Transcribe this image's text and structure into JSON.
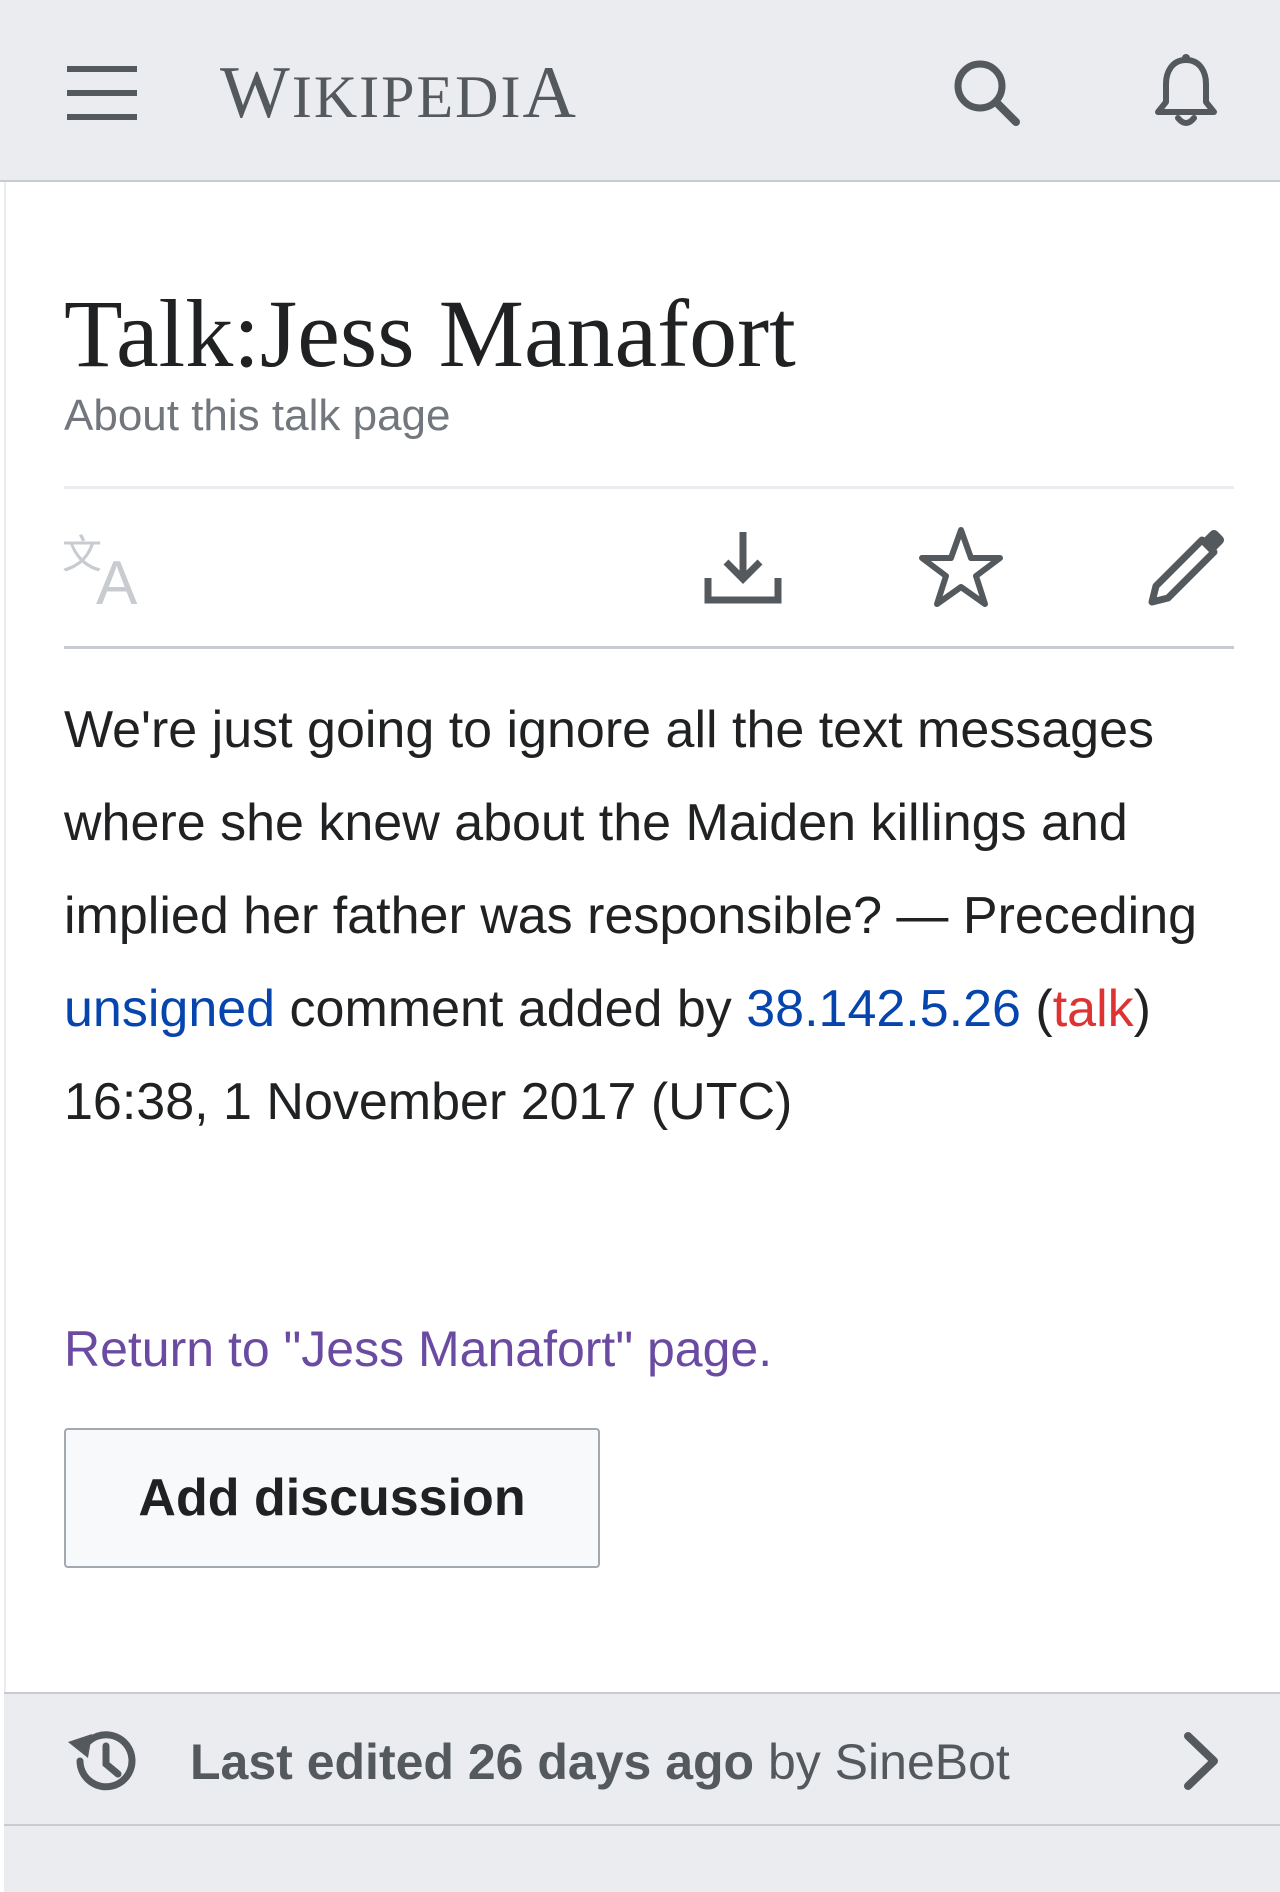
{
  "header": {
    "wordmark_W": "W",
    "wordmark_ikipedi": "IKIPEDI",
    "wordmark_A": "A",
    "icons": [
      "menu-icon",
      "search-icon",
      "bell-icon"
    ]
  },
  "page": {
    "title": "Talk:Jess Manafort",
    "subtitle": "About this talk page"
  },
  "toolbar": {
    "icons": [
      "language-icon",
      "download-icon",
      "star-icon",
      "edit-pencil-icon"
    ]
  },
  "comment": {
    "text_main": "We're just going to ignore all the text messages where she knew about the Maiden killings and implied her father was responsible? — Preceding ",
    "unsigned": "unsigned",
    "text_added_by": " comment added by ",
    "ip": "38.142.5.26",
    "paren_open": " (",
    "talk": "talk",
    "timestamp": ") 16:38, 1 November 2017 (UTC)"
  },
  "return_link": "Return to \"Jess Manafort\" page.",
  "add_button": "Add discussion",
  "footer": {
    "last_edited": "Last edited 26 days ago",
    "by": " by SineBot",
    "icons": [
      "history-icon",
      "chevron-right-icon"
    ]
  },
  "colors": {
    "link_blue": "#0645ad",
    "link_red": "#dd3333",
    "link_visited": "#6b4ba1",
    "chrome_gray": "#eaecf0",
    "icon_gray": "#54595d"
  }
}
